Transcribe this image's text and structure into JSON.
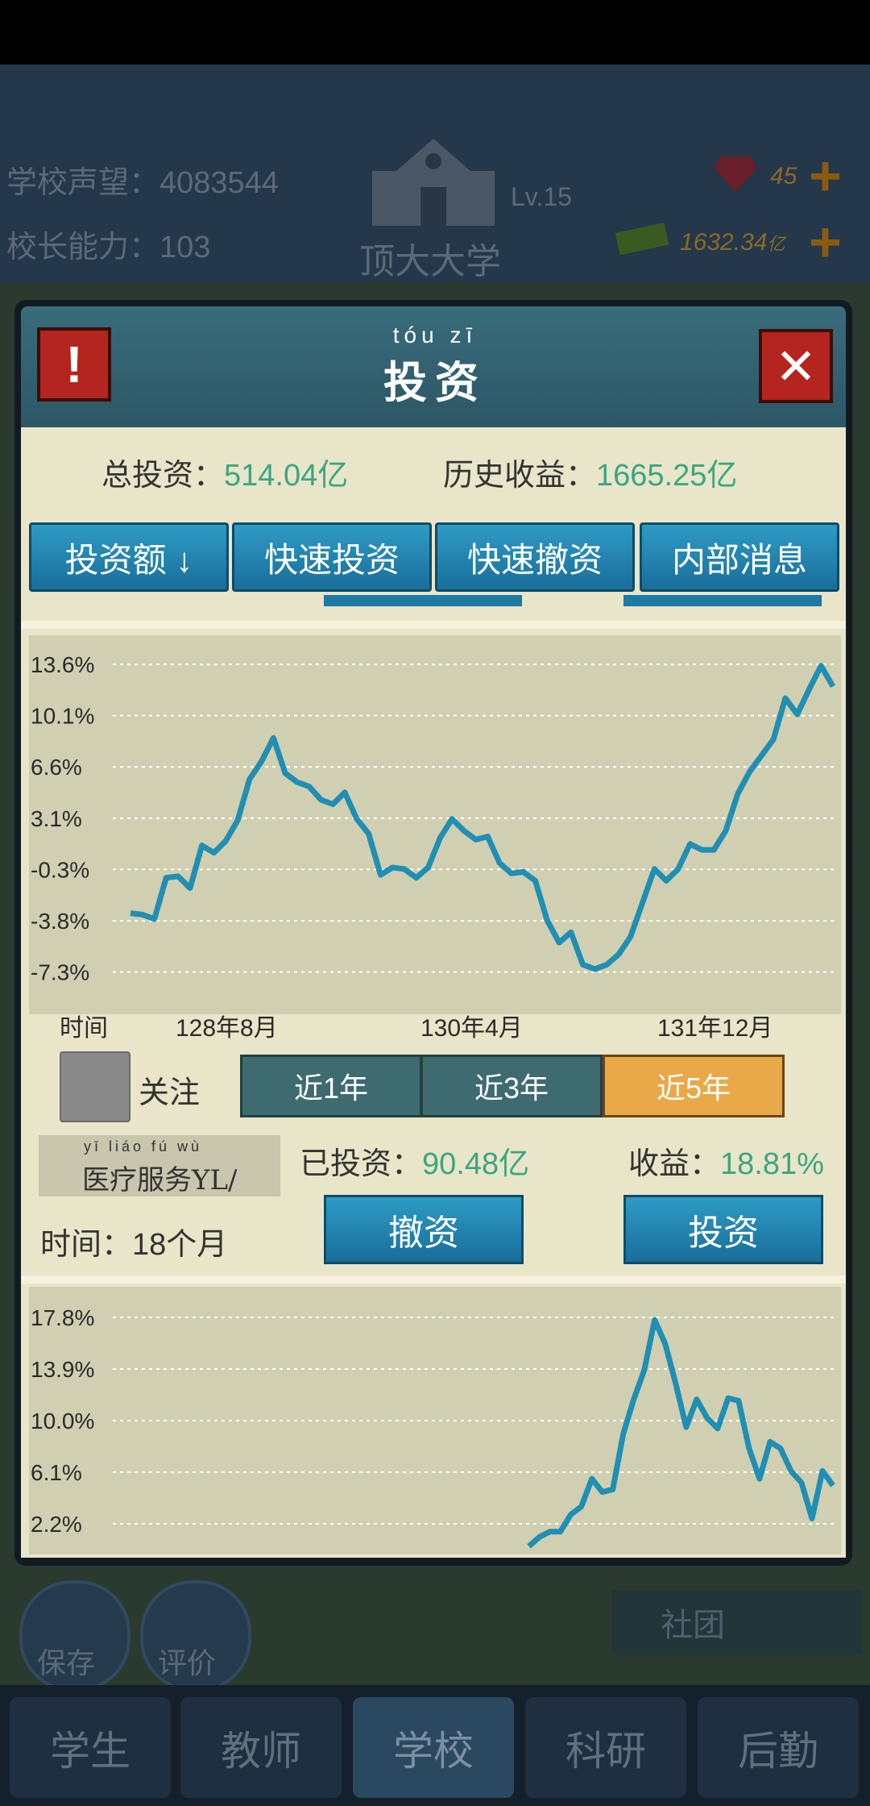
{
  "hud": {
    "reputation_label": "学校声望：",
    "reputation_value": "4083544",
    "ability_label": "校长能力：",
    "ability_value": "103",
    "school_name": "顶大大学",
    "level": "Lv.15",
    "gems": "45",
    "money": "1632.34",
    "money_unit": "亿"
  },
  "side_buttons": {
    "save": "保存",
    "review": "评价",
    "club": "社团"
  },
  "bottom_nav": [
    {
      "label": "学生"
    },
    {
      "label": "教师"
    },
    {
      "label": "学校"
    },
    {
      "label": "科研"
    },
    {
      "label": "后勤"
    }
  ],
  "dialog": {
    "pinyin": "tóu  zī",
    "title": "投资",
    "total_invest_label": "总投资：",
    "total_invest_value": "514.04亿",
    "history_income_label": "历史收益：",
    "history_income_value": "1665.25亿",
    "tabs": [
      "投资额 ↓",
      "快速投资",
      "快速撤资",
      "内部消息"
    ],
    "x_axis_label": "时间",
    "follow_label": "关注",
    "periods": [
      "近1年",
      "近3年",
      "近5年"
    ],
    "active_period": "近5年",
    "fund_pinyin": "yī liáo fú wù",
    "fund_name": "医疗服务YL/",
    "invested_label": "已投资：",
    "invested_value": "90.48亿",
    "income_label": "收益：",
    "income_value": "18.81%",
    "time_label": "时间：",
    "time_value": "18个月",
    "withdraw_button": "撤资",
    "invest_button": "投资"
  },
  "line_color": "#1f8fb3",
  "chart_data": [
    {
      "type": "line",
      "yticks": [
        "13.6%",
        "10.1%",
        "6.6%",
        "3.1%",
        "-0.3%",
        "-3.8%",
        "-7.3%"
      ],
      "ylim": [
        -7.3,
        13.6
      ],
      "xticks": [
        "128年8月",
        "130年4月",
        "131年12月"
      ],
      "series": [
        {
          "values": [
            -3.3,
            -3.4,
            -3.7,
            -0.9,
            -0.8,
            -1.6,
            1.3,
            0.8,
            1.6,
            3.0,
            5.8,
            7.0,
            8.6,
            6.2,
            5.6,
            5.3,
            4.4,
            4.1,
            4.9,
            3.1,
            2.1,
            -0.7,
            -0.2,
            -0.3,
            -0.9,
            -0.2,
            1.8,
            3.1,
            2.3,
            1.7,
            1.9,
            0.1,
            -0.6,
            -0.5,
            -1.1,
            -3.8,
            -5.3,
            -4.6,
            -6.8,
            -7.1,
            -6.8,
            -6.1,
            -4.9,
            -2.6,
            -0.3,
            -1.1,
            -0.3,
            1.4,
            1.0,
            1.0,
            2.3,
            4.8,
            6.3,
            7.4,
            8.5,
            11.3,
            10.2,
            11.9,
            13.5,
            12.1
          ]
        }
      ]
    },
    {
      "type": "line",
      "yticks": [
        "17.8%",
        "13.9%",
        "10.0%",
        "6.1%",
        "2.2%"
      ],
      "ylim": [
        2.2,
        17.8
      ],
      "series": [
        {
          "values": [
            null,
            null,
            null,
            null,
            null,
            null,
            null,
            null,
            null,
            null,
            null,
            null,
            null,
            null,
            null,
            null,
            null,
            null,
            null,
            null,
            null,
            null,
            null,
            null,
            null,
            null,
            null,
            null,
            null,
            null,
            null,
            null,
            null,
            null,
            null,
            null,
            null,
            null,
            0.5,
            1.2,
            1.6,
            1.6,
            2.9,
            3.5,
            5.6,
            4.6,
            4.8,
            9.0,
            11.6,
            13.8,
            17.6,
            15.8,
            12.8,
            9.5,
            11.6,
            10.2,
            9.4,
            11.7,
            11.5,
            7.9,
            5.6,
            8.4,
            7.9,
            6.2,
            5.3,
            2.6,
            6.2,
            5.1
          ]
        }
      ]
    }
  ]
}
